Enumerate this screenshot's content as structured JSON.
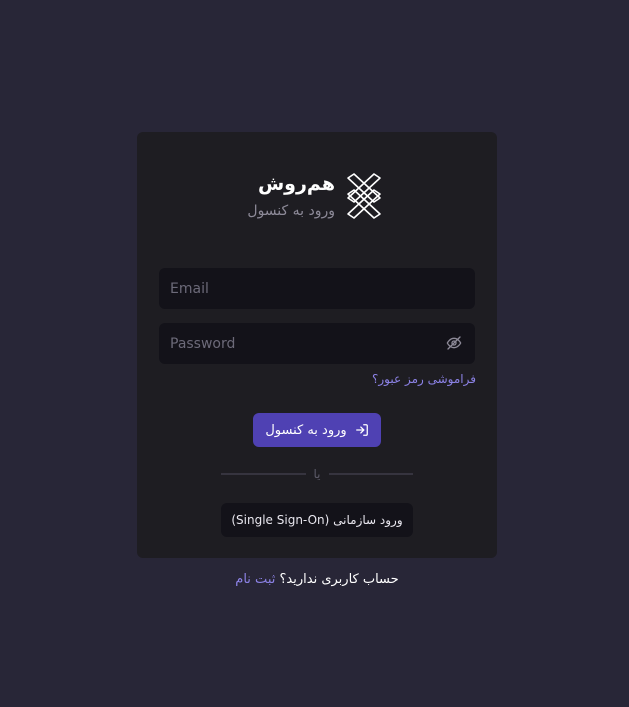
{
  "brand": {
    "name": "هم‌روش",
    "subtitle": "ورود به کنسول",
    "logo_icon": "double-chevron-x-logo"
  },
  "login_form": {
    "email_placeholder": "Email",
    "email_value": "",
    "password_placeholder": "Password",
    "password_value": "",
    "password_toggle_icon": "eye-off-icon",
    "forgot_password": "فراموشی رمز عبور؟",
    "submit_label": "ورود به کنسول",
    "submit_icon": "login-arrow-icon",
    "divider_text": "یا",
    "sso_label": "ورود سازمانی (Single Sign-On)"
  },
  "footer": {
    "question": "حساب کاربری ندارید؟",
    "signup_link": "ثبت نام"
  },
  "colors": {
    "background": "#282637",
    "card": "#1e1d22",
    "input": "#131219",
    "accent": "#4f41b3",
    "link": "#8c82e6"
  }
}
